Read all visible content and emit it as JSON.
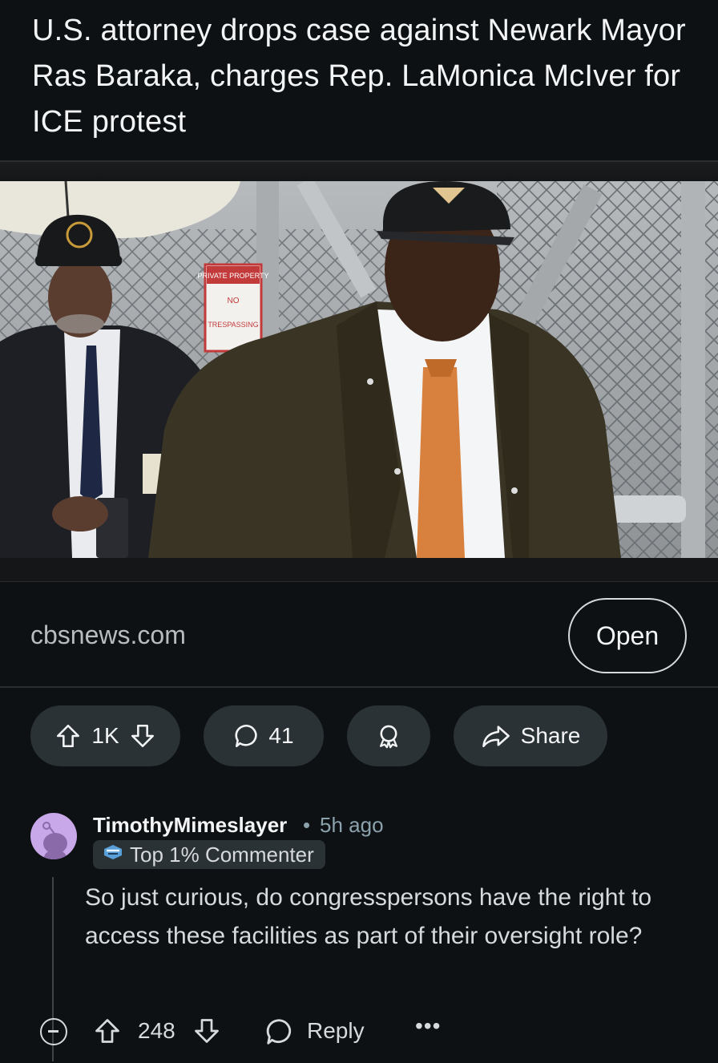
{
  "post": {
    "title": "U.S. attorney drops case against Newark Mayor Ras Baraka, charges Rep. LaMonica McIver for ICE protest",
    "link_domain": "cbsnews.com",
    "open_label": "Open",
    "thumbnail_sign": {
      "line1": "PRIVATE PROPERTY",
      "line2": "NO",
      "line3": "TRESPASSING"
    }
  },
  "actions": {
    "vote_count": "1K",
    "comment_count": "41",
    "share_label": "Share"
  },
  "comment": {
    "username": "TimothyMimeslayer",
    "separator": "•",
    "time_ago": "5h ago",
    "flair": "Top 1% Commenter",
    "body": "So just curious, do congresspersons have the right to access these facilities as part of their oversight role?",
    "vote_count": "248",
    "reply_label": "Reply",
    "more_label": "•••"
  },
  "colors": {
    "background": "#0e1113",
    "pill": "#2a3236",
    "text_primary": "#f2f4f5",
    "text_secondary": "#8ba2ad",
    "avatar": "#c8a8e8"
  }
}
